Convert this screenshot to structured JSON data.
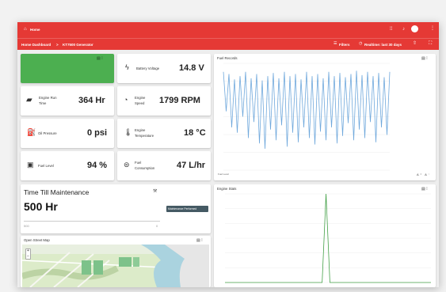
{
  "appbar": {
    "home_label": "Home",
    "grid_icon": "grid-icon",
    "bell_icon": "bell-icon",
    "account_icon": "account-circle-icon",
    "more_icon": "more-vert-icon"
  },
  "breadcrumb": {
    "parent": "Home Dashboard",
    "separator": ">",
    "current": "KT7500 Generator",
    "filters_label": "Filters",
    "time_label": "Realtime: last 30 days"
  },
  "tiles": {
    "battery": {
      "label": "Battery Voltage",
      "value": "14.8 V",
      "icon": "battery-icon"
    },
    "run_time": {
      "label_1": "Engine Run",
      "label_2": "Time",
      "value": "364 Hr",
      "icon": "engine-icon"
    },
    "speed": {
      "label_1": "Engine",
      "label_2": "Speed",
      "value": "1799 RPM",
      "icon": "speedometer-icon"
    },
    "oil": {
      "label": "Oil Pressure",
      "value": "0 psi",
      "icon": "oil-can-icon"
    },
    "temp": {
      "label_1": "Engine",
      "label_2": "Temperature",
      "value": "18 °C",
      "icon": "thermometer-icon"
    },
    "fuel_level": {
      "label": "Fuel Level",
      "value": "94 %",
      "icon": "fuel-gauge-icon"
    },
    "fuel_consumption": {
      "label_1": "Fuel",
      "label_2": "Consumption",
      "value": "47 L/hr",
      "icon": "fuel-consumption-icon"
    }
  },
  "maintenance": {
    "title": "Time Till Maintenance",
    "value": "500 Hr",
    "progress": 0,
    "scale_min": "500",
    "scale_max": "0",
    "button_label": "Maintenance Performed"
  },
  "map_card": {
    "title": "Open Street Map",
    "zoom_in": "+",
    "zoom_out": "−"
  },
  "fuel_chart": {
    "title": "Fuel Records",
    "legend": "Fuel Level"
  },
  "engine_chart": {
    "title": "Engine Stats"
  },
  "chart_data": [
    {
      "type": "line",
      "title": "Fuel Records",
      "series": [
        {
          "name": "Fuel Level",
          "values": [
            92,
            55,
            90,
            40,
            85,
            35,
            88,
            50,
            92,
            30,
            86,
            45,
            90,
            25,
            84,
            20,
            88,
            38,
            91,
            28,
            86,
            42,
            92,
            22,
            88,
            35,
            90,
            26,
            85,
            40,
            92,
            30,
            88,
            24,
            90,
            36,
            86,
            28,
            92,
            40,
            88,
            25,
            91,
            32,
            87,
            44,
            90,
            28,
            93,
            38,
            89,
            30,
            92,
            45,
            88,
            26,
            91,
            40,
            87,
            33,
            92
          ]
        }
      ],
      "ylim": [
        0,
        100
      ],
      "grid": true,
      "legend": "bottom-left"
    },
    {
      "type": "line",
      "title": "Engine Stats",
      "series": [
        {
          "name": "",
          "values": [
            0,
            0,
            0,
            0,
            0,
            0,
            0,
            0,
            0,
            0,
            0,
            0,
            0,
            0,
            0,
            0,
            0,
            0,
            0,
            0,
            0,
            0,
            0,
            0,
            0,
            0,
            100,
            0,
            0,
            0,
            0,
            0,
            0,
            0,
            0,
            0,
            0,
            0,
            0,
            0,
            0,
            0,
            0,
            0,
            0,
            0,
            0,
            0,
            0,
            0,
            0,
            0,
            0,
            0
          ]
        }
      ],
      "ylim": [
        0,
        100
      ],
      "grid": true
    }
  ],
  "colors": {
    "brand": "#e53935",
    "accent_tile": "#4caf50",
    "fuel_line": "#6fa8dc",
    "engine_line": "#43a047",
    "button": "#455a64"
  }
}
